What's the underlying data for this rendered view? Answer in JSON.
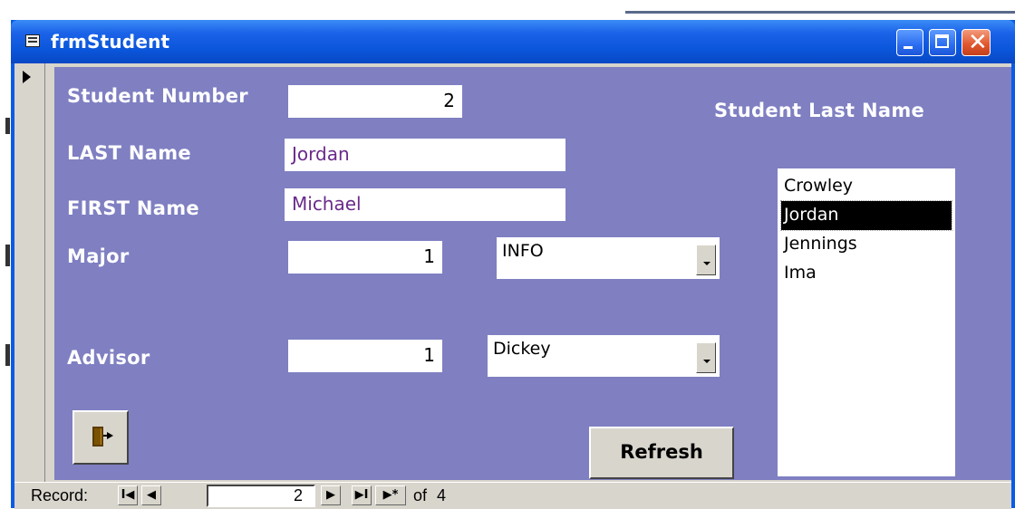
{
  "window": {
    "title": "frmStudent"
  },
  "labels": {
    "student_number": "Student Number",
    "last_name": "LAST Name",
    "first_name": "FIRST Name",
    "major": "Major",
    "advisor": "Advisor",
    "list_header": "Student Last Name"
  },
  "fields": {
    "student_number": "2",
    "last_name": "Jordan",
    "first_name": "Michael",
    "major_id": "1",
    "major_combo": "INFO",
    "advisor_id": "1",
    "advisor_combo": "Dickey"
  },
  "listbox": {
    "items": [
      "Crowley",
      "Jordan",
      "Jennings",
      "Ima"
    ],
    "selected": "Jordan"
  },
  "buttons": {
    "refresh": "Refresh",
    "exit_icon": "exit-door-icon"
  },
  "navigation": {
    "label": "Record:",
    "current": "2",
    "of": "of",
    "total": "4",
    "first": "I◀",
    "prev": "◀",
    "next": "▶",
    "last": "▶I",
    "new": "▶*"
  },
  "colors": {
    "form_background": "#7f7fc2",
    "titlebar": "#0a5ce6",
    "text_value": "#6a2a8a"
  }
}
